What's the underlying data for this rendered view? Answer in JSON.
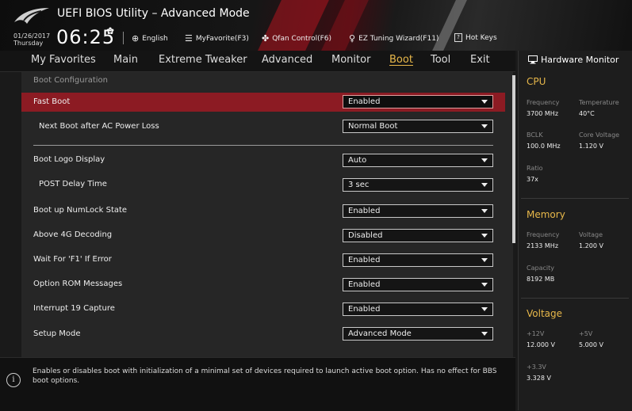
{
  "header": {
    "title": "UEFI BIOS Utility – Advanced Mode",
    "date": "01/26/2017",
    "day": "Thursday",
    "time": "06:25",
    "toolbar": {
      "language": "English",
      "my_favorite": "MyFavorite(F3)",
      "qfan": "Qfan Control(F6)",
      "ez_tuning": "EZ Tuning Wizard(F11)",
      "hot_keys": "Hot Keys",
      "hot_keys_key": "?"
    }
  },
  "nav": {
    "tabs": [
      "My Favorites",
      "Main",
      "Extreme Tweaker",
      "Advanced",
      "Monitor",
      "Boot",
      "Tool",
      "Exit"
    ],
    "active": "Boot"
  },
  "main": {
    "section_title": "Boot Configuration",
    "rows": [
      {
        "label": "Fast Boot",
        "value": "Enabled"
      },
      {
        "label": "Next Boot after AC Power Loss",
        "value": "Normal Boot"
      },
      {
        "label": "Boot Logo Display",
        "value": "Auto"
      },
      {
        "label": "POST Delay Time",
        "value": "3 sec"
      },
      {
        "label": "Boot up NumLock State",
        "value": "Enabled"
      },
      {
        "label": "Above 4G Decoding",
        "value": "Disabled"
      },
      {
        "label": "Wait For 'F1' If Error",
        "value": "Enabled"
      },
      {
        "label": "Option ROM Messages",
        "value": "Enabled"
      },
      {
        "label": "Interrupt 19 Capture",
        "value": "Enabled"
      },
      {
        "label": "Setup Mode",
        "value": "Advanced Mode"
      }
    ]
  },
  "info": {
    "text": "Enables or disables boot with initialization of a minimal set of devices required to launch active boot option. Has no effect for BBS boot options."
  },
  "hw_monitor": {
    "title": "Hardware Monitor",
    "cpu": {
      "title": "CPU",
      "frequency_label": "Frequency",
      "frequency": "3700 MHz",
      "temperature_label": "Temperature",
      "temperature": "40°C",
      "bclk_label": "BCLK",
      "bclk": "100.0 MHz",
      "core_voltage_label": "Core Voltage",
      "core_voltage": "1.120 V",
      "ratio_label": "Ratio",
      "ratio": "37x"
    },
    "memory": {
      "title": "Memory",
      "frequency_label": "Frequency",
      "frequency": "2133 MHz",
      "voltage_label": "Voltage",
      "voltage": "1.200 V",
      "capacity_label": "Capacity",
      "capacity": "8192 MB"
    },
    "voltage": {
      "title": "Voltage",
      "v12_label": "+12V",
      "v12": "12.000 V",
      "v5_label": "+5V",
      "v5": "5.000 V",
      "v33_label": "+3.3V",
      "v33": "3.328 V"
    }
  },
  "colors": {
    "accent": "#e8b84a",
    "highlight_row": "#8c1b23"
  }
}
